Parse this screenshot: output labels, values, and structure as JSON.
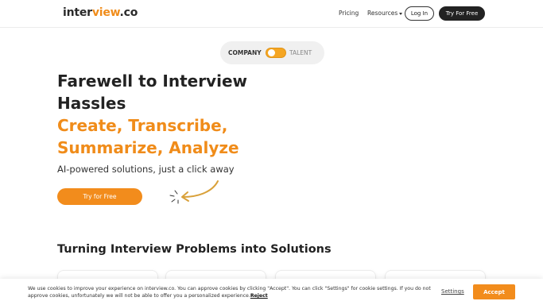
{
  "header": {
    "logo_main": "inter",
    "logo_accent": "view",
    "logo_suffix": ".co",
    "nav": {
      "pricing": "Pricing",
      "resources": "Resources"
    },
    "login_label": "Log In",
    "try_label": "Try For Free"
  },
  "toggle": {
    "left_label": "COMPANY",
    "right_label": "TALENT",
    "state": "company"
  },
  "hero": {
    "title": "Farewell to Interview Hassles",
    "accent": "Create, Transcribe, Summarize, Analyze",
    "subtitle": "AI-powered solutions, just a click away",
    "cta_label": "Try for Free"
  },
  "section": {
    "title": "Turning Interview Problems into Solutions"
  },
  "cookie": {
    "text": "We use cookies to improve your experience on interview.co. You can approve cookies by clicking \"Accept\". You can click \"Settings\" for cookie settings. If you do not approve cookies, unfortunately we will not be able to offer you a personalized experience.",
    "reject_label": "Reject",
    "settings_label": "Settings",
    "accept_label": "Accept"
  },
  "colors": {
    "brand_orange": "#f28c1c",
    "dark": "#222222",
    "arrow": "#d9a13a"
  },
  "icons": {
    "resources_caret": "chevron-down-icon",
    "hero_arrow": "curved-arrow-icon"
  }
}
